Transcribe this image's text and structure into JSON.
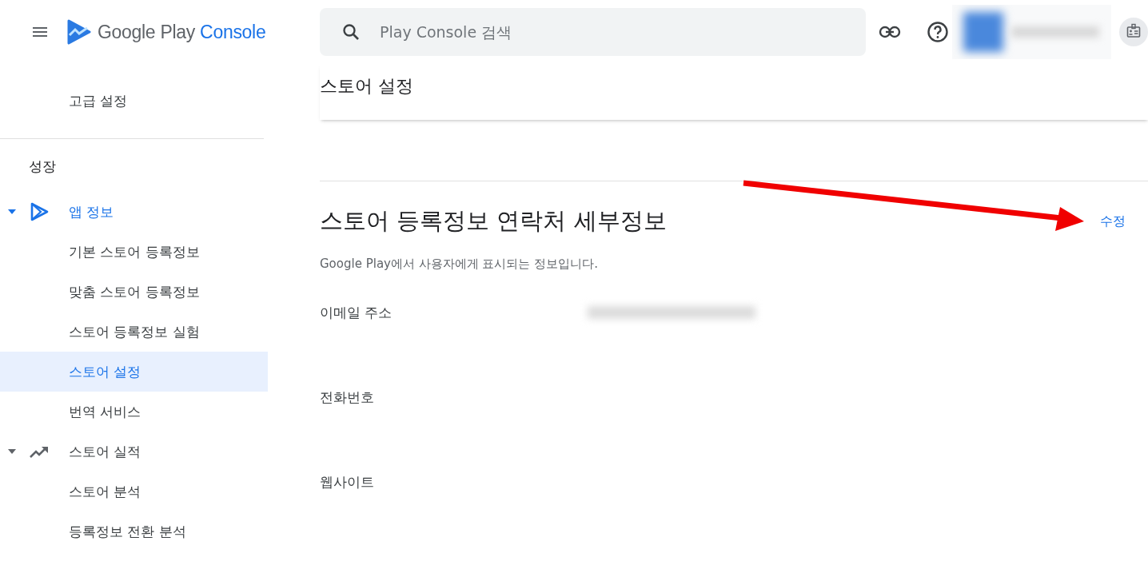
{
  "header": {
    "logo_text": "Google Play",
    "logo_accent": "Console",
    "search": {
      "placeholder": "Play Console 검색"
    }
  },
  "sidebar": {
    "top_items": [
      {
        "label": "고급 설정",
        "selected": false
      }
    ],
    "section_title": "성장",
    "groups": [
      {
        "label": "앱 정보",
        "kind": "play",
        "expanded": true,
        "active": true,
        "children": [
          {
            "label": "기본 스토어 등록정보",
            "selected": false
          },
          {
            "label": "맞춤 스토어 등록정보",
            "selected": false
          },
          {
            "label": "스토어 등록정보 실험",
            "selected": false
          },
          {
            "label": "스토어 설정",
            "selected": true
          },
          {
            "label": "번역 서비스",
            "selected": false
          }
        ]
      },
      {
        "label": "스토어 실적",
        "kind": "trend",
        "expanded": true,
        "active": false,
        "children": [
          {
            "label": "스토어 분석",
            "selected": false
          },
          {
            "label": "등록정보 전환 분석",
            "selected": false
          }
        ]
      }
    ]
  },
  "page_title": "스토어 설정",
  "section": {
    "title": "스토어 등록정보 연락처 세부정보",
    "edit_link": "수정",
    "description": "Google Play에서 사용자에게 표시되는 정보입니다.",
    "fields": [
      {
        "label": "이메일 주소",
        "kind": "blurred"
      },
      {
        "label": "전화번호",
        "kind": "empty"
      },
      {
        "label": "웹사이트",
        "kind": "empty"
      }
    ]
  }
}
